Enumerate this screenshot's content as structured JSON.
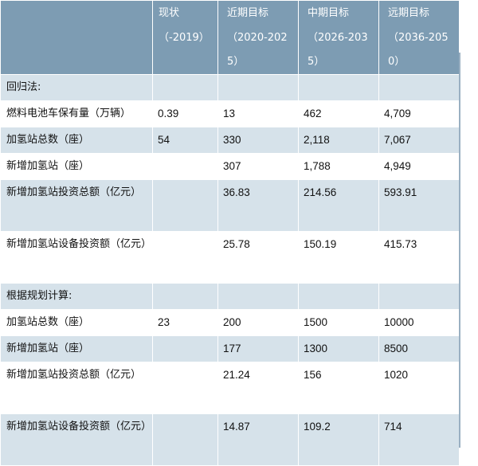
{
  "header": {
    "col0": "",
    "col1_line1": "现状",
    "col1_line2": "（-2019）",
    "col2_line1": "近期目标",
    "col2_line2": "（2020-2025）",
    "col3_line1": "中期目标",
    "col3_line2": "（2026-2035）",
    "col4_line1": "远期目标",
    "col4_line2": "（2036-2050）"
  },
  "section_regression": "回归法:",
  "section_planning": "根据规划计算:",
  "regression_rows": [
    {
      "label": "燃料电池车保有量（万辆）",
      "v1": "0.39",
      "v2": "13",
      "v3": "462",
      "v4": "4,709"
    },
    {
      "label": "加氢站总数（座）",
      "v1": "54",
      "v2": "330",
      "v3": "2,118",
      "v4": "7,067"
    },
    {
      "label": "新增加氢站（座）",
      "v1": "",
      "v2": "307",
      "v3": "1,788",
      "v4": "4,949"
    },
    {
      "label": "新增加氢站投资总额（亿元）",
      "v1": "",
      "v2": "36.83",
      "v3": "214.56",
      "v4": "593.91"
    },
    {
      "label": "新增加氢站设备投资额（亿元）",
      "v1": "",
      "v2": "25.78",
      "v3": "150.19",
      "v4": "415.73"
    }
  ],
  "planning_rows": [
    {
      "label": "加氢站总数（座）",
      "v1": "23",
      "v2": "200",
      "v3": "1500",
      "v4": "10000"
    },
    {
      "label": "新增加氢站（座）",
      "v1": "",
      "v2": "177",
      "v3": "1300",
      "v4": "8500"
    },
    {
      "label": "新增加氢站投资总额（亿元）",
      "v1": "",
      "v2": "21.24",
      "v3": "156",
      "v4": "1020"
    },
    {
      "label": "新增加氢站设备投资额（亿元）",
      "v1": "",
      "v2": "14.87",
      "v3": "109.2",
      "v4": "714"
    }
  ],
  "colors": {
    "header_bg": "#7d9cb3",
    "shade_bg": "#d6e2ea",
    "text": "#111111"
  }
}
